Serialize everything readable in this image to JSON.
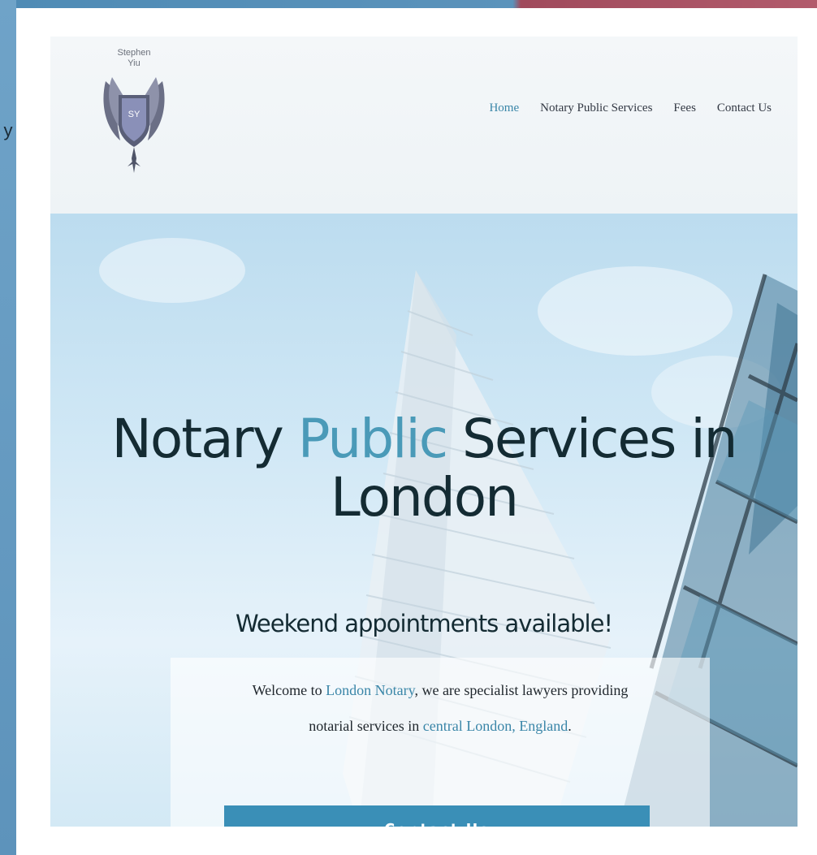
{
  "frame": {
    "left_glyph": "y",
    "colors": {
      "left_strip": "#6fa3c8",
      "top_strip_blue": "#4f8bb5",
      "top_strip_red": "#b25b6c"
    }
  },
  "site": {
    "logo": {
      "name_line1": "Stephen",
      "name_line2": "Yiu",
      "monogram": "SY"
    },
    "nav": {
      "items": [
        {
          "label": "Home",
          "active": true
        },
        {
          "label": "Notary Public Services",
          "active": false
        },
        {
          "label": "Fees",
          "active": false
        },
        {
          "label": "Contact Us",
          "active": false
        }
      ]
    },
    "hero": {
      "title_part1": "Notary ",
      "title_accent": "Public",
      "title_part2": " Services in",
      "title_line2": "London",
      "subtitle": "Weekend appointments available!",
      "welcome_line1_a": "Welcome to ",
      "welcome_link1": "London Notary",
      "welcome_line1_b": ", we are specialist lawyers providing",
      "welcome_line2_a": "notarial services in ",
      "welcome_link2": "central London, England",
      "welcome_line2_b": ".",
      "cta_label": "Contact Us"
    },
    "colors": {
      "accent": "#3a86a8",
      "cta_background": "#3a8fb7",
      "title_text": "#142b33"
    }
  }
}
